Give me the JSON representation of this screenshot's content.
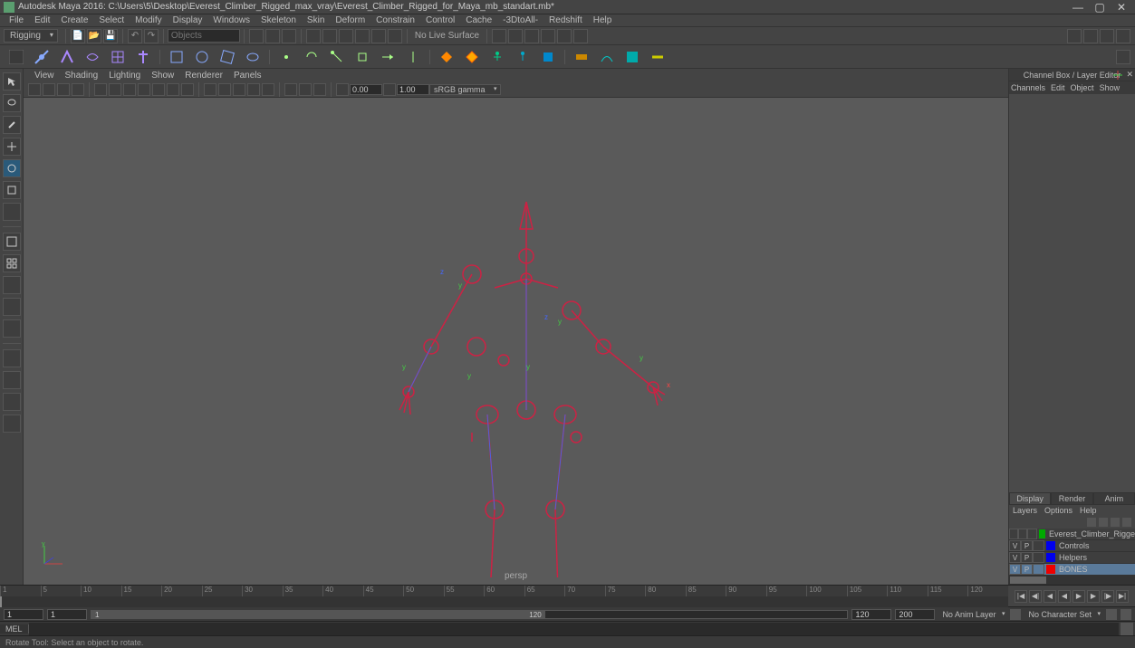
{
  "titlebar": {
    "title": "Autodesk Maya 2016: C:\\Users\\5\\Desktop\\Everest_Climber_Rigged_max_vray\\Everest_Climber_Rigged_for_Maya_mb_standart.mb*"
  },
  "menubar": {
    "items": [
      "File",
      "Edit",
      "Create",
      "Select",
      "Modify",
      "Display",
      "Windows",
      "Skeleton",
      "Skin",
      "Deform",
      "Constrain",
      "Control",
      "Cache",
      "-3DtoAll-",
      "Redshift",
      "Help"
    ]
  },
  "toolrow1": {
    "mode": "Rigging",
    "search_placeholder": "Objects",
    "surface_label": "No Live Surface"
  },
  "vp_menubar": {
    "items": [
      "View",
      "Shading",
      "Lighting",
      "Show",
      "Renderer",
      "Panels"
    ]
  },
  "vp_toolbar": {
    "val1": "0.00",
    "val2": "1.00",
    "gamma": "sRGB gamma"
  },
  "viewport": {
    "camera": "persp"
  },
  "rightpanel": {
    "header": "Channel Box / Layer Editor",
    "tabs": [
      "Channels",
      "Edit",
      "Object",
      "Show"
    ],
    "bottom_tabs": [
      "Display",
      "Render",
      "Anim"
    ],
    "bottom_menu": [
      "Layers",
      "Options",
      "Help"
    ],
    "layers": [
      {
        "v": "",
        "p": "",
        "r": "",
        "color": "#00aa00",
        "name": "Everest_Climber_Rigge",
        "sel": false
      },
      {
        "v": "V",
        "p": "P",
        "r": "",
        "color": "#0000ee",
        "name": "Controls",
        "sel": false
      },
      {
        "v": "V",
        "p": "P",
        "r": "",
        "color": "#0000ee",
        "name": "Helpers",
        "sel": false
      },
      {
        "v": "V",
        "p": "P",
        "r": "",
        "color": "#ee0000",
        "name": "BONES",
        "sel": true
      }
    ]
  },
  "timeline": {
    "ticks": [
      "1",
      "5",
      "10",
      "15",
      "20",
      "25",
      "30",
      "35",
      "40",
      "45",
      "50",
      "55",
      "60",
      "65",
      "70",
      "75",
      "80",
      "85",
      "90",
      "95",
      "100",
      "105",
      "110",
      "115",
      "120"
    ],
    "current": "1"
  },
  "rangebar": {
    "start_outer": "1",
    "start_inner": "1",
    "range_marker": "1",
    "end_marker": "120",
    "end_inner": "120",
    "end_outer": "200",
    "anim_layer": "No Anim Layer",
    "char_set": "No Character Set"
  },
  "cmdline": {
    "lang": "MEL"
  },
  "statusbar": {
    "msg": "Rotate Tool: Select an object to rotate."
  }
}
